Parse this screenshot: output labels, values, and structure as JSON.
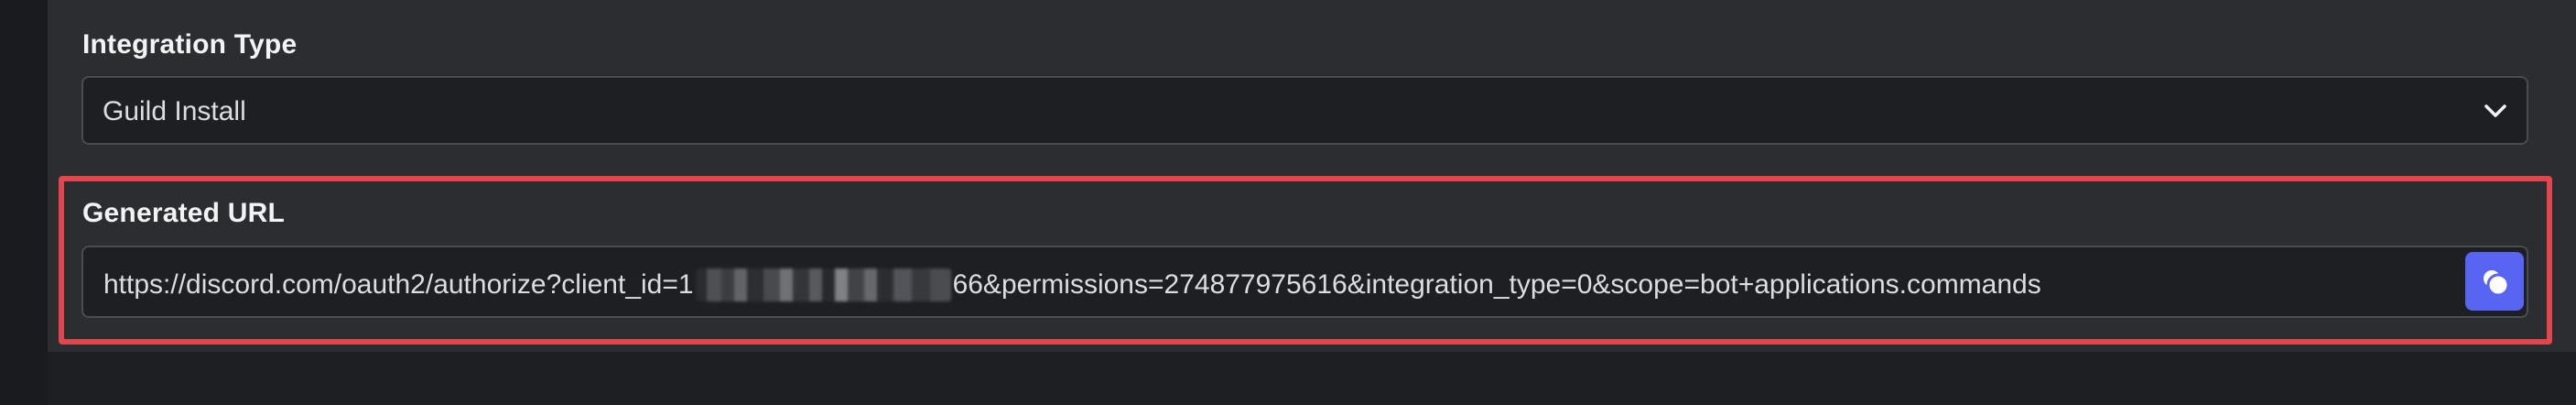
{
  "integration": {
    "label": "Integration Type",
    "selected_value": "Guild Install",
    "chevron_icon": "chevron-down-icon"
  },
  "generated_url": {
    "label": "Generated URL",
    "url_prefix": "https://discord.com/oauth2/authorize?client_id=1",
    "url_suffix": "66&permissions=274877975616&integration_type=0&scope=bot+applications.commands",
    "copy_icon": "copy-icon"
  },
  "colors": {
    "highlight": "#e0474c",
    "copy_button": "#5865f2",
    "panel_background": "#2b2d31",
    "page_background": "#1e1f22"
  }
}
